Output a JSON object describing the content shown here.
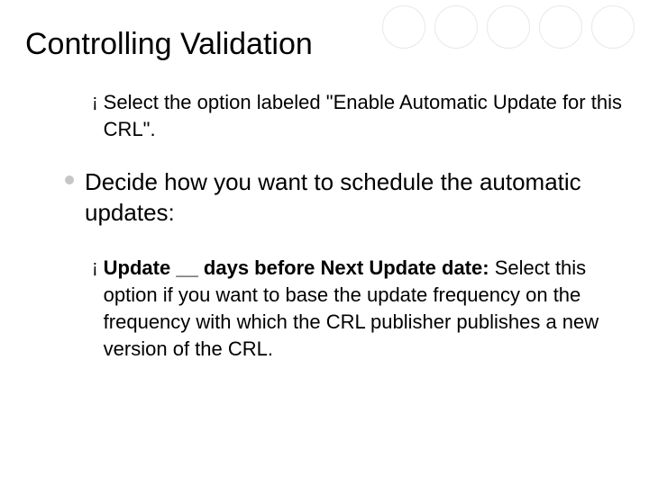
{
  "title": "Controlling Validation",
  "sub1": {
    "lead": "Select",
    "rest": " the option labeled \"Enable Automatic Update for this CRL\"."
  },
  "bullet1": {
    "lead": "Decide",
    "rest": " how you want to schedule the automatic updates:"
  },
  "sub2": {
    "bold": "Update __ days before Next Update date:",
    "rest": " Select this option if you want to base the update frequency on the frequency with which the CRL publisher publishes a new version of the CRL."
  }
}
